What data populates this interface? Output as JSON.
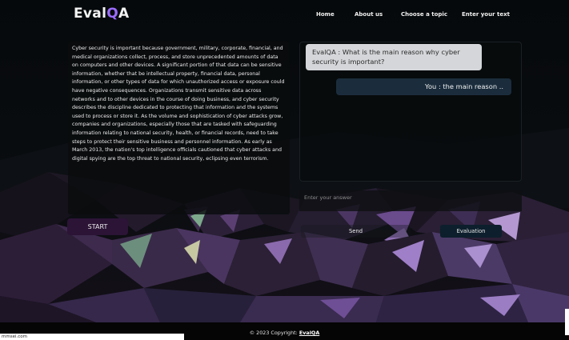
{
  "brand": {
    "name_prefix": "Eval",
    "name_q": "Q",
    "name_suffix": "A"
  },
  "nav": {
    "items": [
      {
        "label": "Home"
      },
      {
        "label": "About us"
      },
      {
        "label": "Choose a topic"
      },
      {
        "label": "Enter your text"
      }
    ]
  },
  "passage": {
    "text": "Cyber security is important because government, military, corporate, financial, and medical organizations collect, process, and store unprecedented amounts of data on computers and other devices. A significant portion of that data can be sensitive information, whether that be intellectual property, financial data, personal information, or other types of data for which unauthorized access or exposure could have negative consequences. Organizations transmit sensitive data across networks and to other devices in the course of doing business, and cyber security describes the discipline dedicated to protecting that information and the systems used to process or store it. As the volume and sophistication of cyber attacks grow, companies and organizations, especially those that are tasked with safeguarding information relating to national security, health, or financial records, need to take steps to protect their sensitive business and personnel information. As early as March 2013, the nation's top intelligence officials cautioned that cyber attacks and digital spying are the top threat to national security, eclipsing even terrorism."
  },
  "chat": {
    "bot_message": "EvalQA : What is the main reason why cyber security is important?",
    "user_message": "You : the main reason .."
  },
  "answer": {
    "placeholder": "Enter your answer"
  },
  "buttons": {
    "start": "START",
    "send": "Send",
    "evaluation": "Evaluation"
  },
  "footer": {
    "copyright": "© 2023 Copyright:",
    "link": "EvalQA"
  },
  "status_bar": {
    "url": "mmsei.com"
  },
  "colors": {
    "accent_purple": "#9a6cff",
    "bubble_bot": "#d4d6d9",
    "bubble_user": "#1b2d3d",
    "start_button": "#2b1436",
    "evaluation_button": "#0d1f2c"
  }
}
